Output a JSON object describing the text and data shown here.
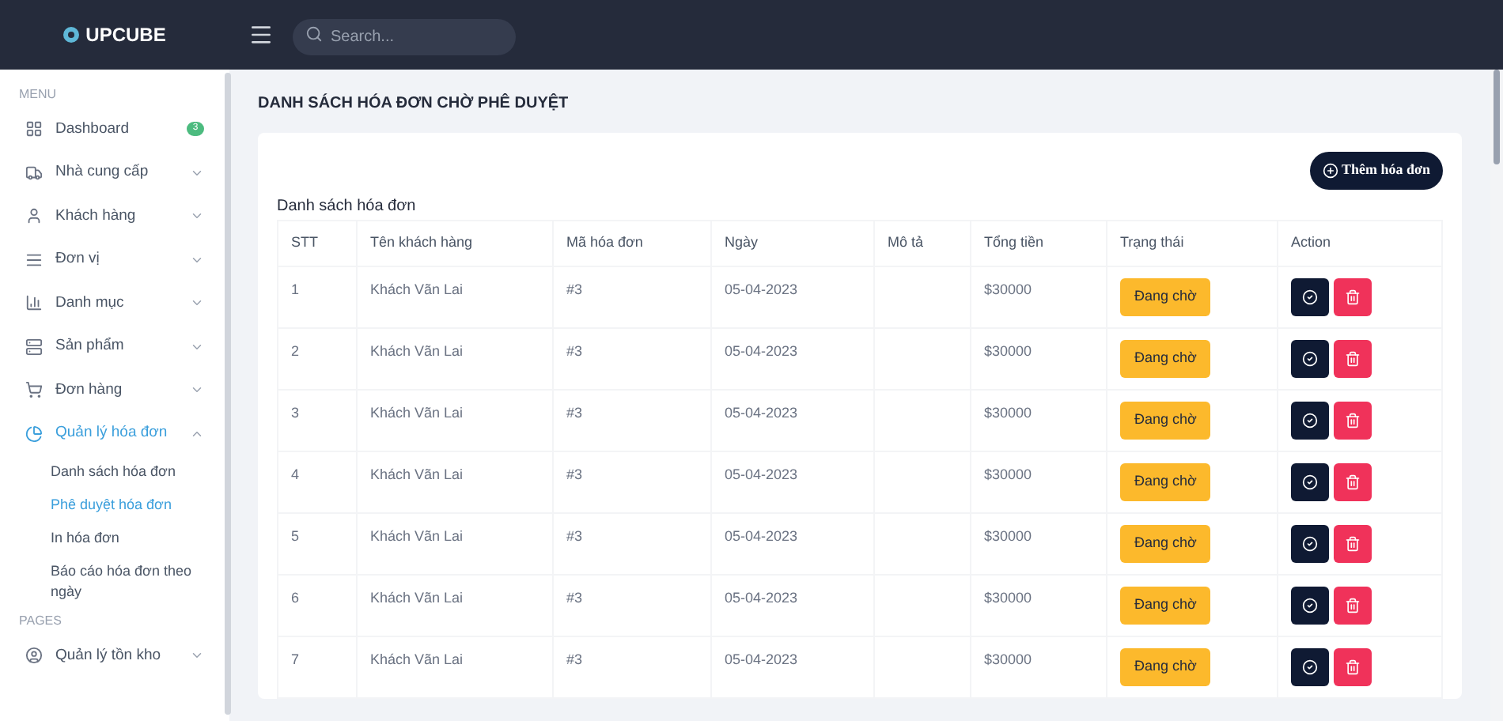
{
  "brand": "UPCUBE",
  "search": {
    "placeholder": "Search..."
  },
  "sidebar": {
    "sections": [
      {
        "title": "MENU",
        "items": [
          {
            "label": "Dashboard",
            "badge": "3",
            "selected": false
          },
          {
            "label": "Nhà cung cấp",
            "expanded": false,
            "selected": false
          },
          {
            "label": "Khách hàng",
            "expanded": false,
            "selected": false
          },
          {
            "label": "Đơn vị",
            "expanded": false,
            "selected": false
          },
          {
            "label": "Danh mục",
            "expanded": false,
            "selected": false
          },
          {
            "label": "Sản phẩm",
            "expanded": false,
            "selected": false
          },
          {
            "label": "Đơn hàng",
            "expanded": false,
            "selected": false
          },
          {
            "label": "Quản lý hóa đơn",
            "expanded": true,
            "selected": true,
            "children": [
              {
                "label": "Danh sách hóa đơn",
                "selected": false
              },
              {
                "label": "Phê duyệt hóa đơn",
                "selected": true
              },
              {
                "label": "In hóa đơn",
                "selected": false
              },
              {
                "label": "Báo cáo hóa đơn theo ngày",
                "selected": false
              }
            ]
          }
        ]
      },
      {
        "title": "PAGES",
        "items": [
          {
            "label": "Quản lý tồn kho",
            "expanded": false,
            "selected": false
          }
        ]
      }
    ]
  },
  "page_title": "DANH SÁCH HÓA ĐƠN CHỜ PHÊ DUYỆT",
  "add_button": "Thêm hóa đơn",
  "table": {
    "title": "Danh sách hóa đơn",
    "columns": [
      "STT",
      "Tên khách hàng",
      "Mã hóa đơn",
      "Ngày",
      "Mô tả",
      "Tổng tiền",
      "Trạng thái",
      "Action"
    ],
    "rows": [
      {
        "stt": "1",
        "customer": "Khách Vãn Lai",
        "code": "#3",
        "date": "05-04-2023",
        "total": "$30000",
        "status": "Đang chờ"
      },
      {
        "stt": "2",
        "customer": "Khách Vãn Lai",
        "code": "#3",
        "date": "05-04-2023",
        "total": "$30000",
        "status": "Đang chờ"
      },
      {
        "stt": "3",
        "customer": "Khách Vãn Lai",
        "code": "#3",
        "date": "05-04-2023",
        "total": "$30000",
        "status": "Đang chờ"
      },
      {
        "stt": "4",
        "customer": "Khách Vãn Lai",
        "code": "#3",
        "date": "05-04-2023",
        "total": "$30000",
        "status": "Đang chờ"
      },
      {
        "stt": "5",
        "customer": "Khách Vãn Lai",
        "code": "#3",
        "date": "05-04-2023",
        "total": "$30000",
        "status": "Đang chờ"
      },
      {
        "stt": "6",
        "customer": "Khách Vãn Lai",
        "code": "#3",
        "date": "05-04-2023",
        "total": "$30000",
        "status": "Đang chờ"
      },
      {
        "stt": "7",
        "customer": "Khách Vãn Lai",
        "code": "#3",
        "date": "05-04-2023",
        "total": "$30000",
        "status": "Đang chờ"
      }
    ]
  }
}
